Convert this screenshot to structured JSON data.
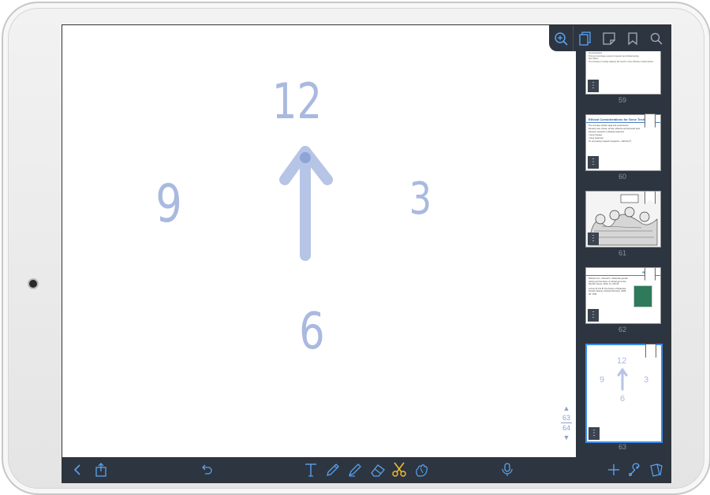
{
  "canvas": {
    "numbers": {
      "twelve": "12",
      "three": "3",
      "six": "6",
      "nine": "9"
    },
    "ink_color": "#a9b9e0"
  },
  "sidebar": {
    "thumbnails": [
      {
        "page": "59",
        "lines": [
          "Increased testing capacity for individual, private, and expensive to obtain as well as for children with rare diseases",
          "Genes/Variants",
          "This test must have a report of genetic and clinical testing",
          "Next Steps",
          "The increase in testing capacity will result in more effective medical advice"
        ]
      },
      {
        "page": "60",
        "title": "Ethical Considerations for Gene Testing",
        "lines": [
          "The increase ethical, legal and social issues",
          "Develop new, cheap, simple, effective and accurate tests",
          "Advance research in disease treatment",
          "• Gene therapy",
          "• Drug treatment",
          "It's an growing magnet? (eugenics - half-born?)"
        ]
      },
      {
        "page": "61"
      },
      {
        "page": "62",
        "title": "Refs",
        "refs": [
          "Roberts G.H., Kanuta N., Molecular genetic testing and the future of clinical genomics. Nat Rev Genet. 2013; 14: 415-26",
          "Lennox R.H.S.B. The Future of Molecular Genetic Testing. Clinical Chemistry. 2005; 48: 1795-"
        ]
      },
      {
        "page": "63",
        "numbers": [
          "12",
          "9",
          "3",
          "6"
        ]
      }
    ]
  },
  "scroller": {
    "up": "▲",
    "current": "63",
    "total": "64",
    "down": "▼"
  },
  "colors": {
    "accent": "#3d8fe6",
    "bar": "#2d3540",
    "highlighter": "#f2b92b"
  }
}
